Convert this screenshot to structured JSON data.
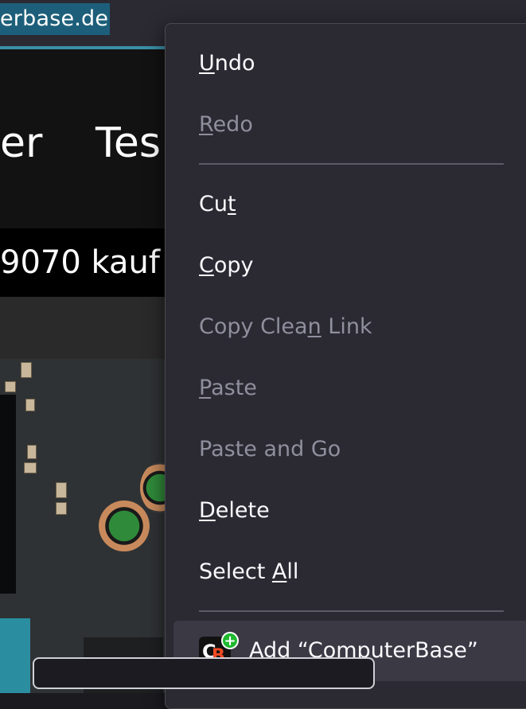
{
  "browser": {
    "url_fragment": "erbase.de"
  },
  "page": {
    "nav_left_fragment": "er",
    "nav_right_fragment": "Tes",
    "headline_fragment": "9070 kauf"
  },
  "context_menu": {
    "items": [
      {
        "pre": "",
        "key": "U",
        "post": "ndo",
        "disabled": false
      },
      {
        "pre": "",
        "key": "R",
        "post": "edo",
        "disabled": true
      },
      {
        "pre": "Cu",
        "key": "t",
        "post": "",
        "disabled": false
      },
      {
        "pre": "",
        "key": "C",
        "post": "opy",
        "disabled": false
      },
      {
        "pre": "Copy Clea",
        "key": "n",
        "post": " Link",
        "disabled": true
      },
      {
        "pre": "",
        "key": "P",
        "post": "aste",
        "disabled": true
      },
      {
        "pre": "Paste and Go",
        "key": "",
        "post": "",
        "disabled": true
      },
      {
        "pre": "",
        "key": "D",
        "post": "elete",
        "disabled": false
      },
      {
        "pre": "Select ",
        "key": "A",
        "post": "ll",
        "disabled": false
      }
    ],
    "add_search_engine": {
      "label": "Add “ComputerBase”",
      "icon_letters": {
        "c": "C",
        "b": "B"
      },
      "badge": "+",
      "icon": "computerbase-logo-icon"
    }
  }
}
